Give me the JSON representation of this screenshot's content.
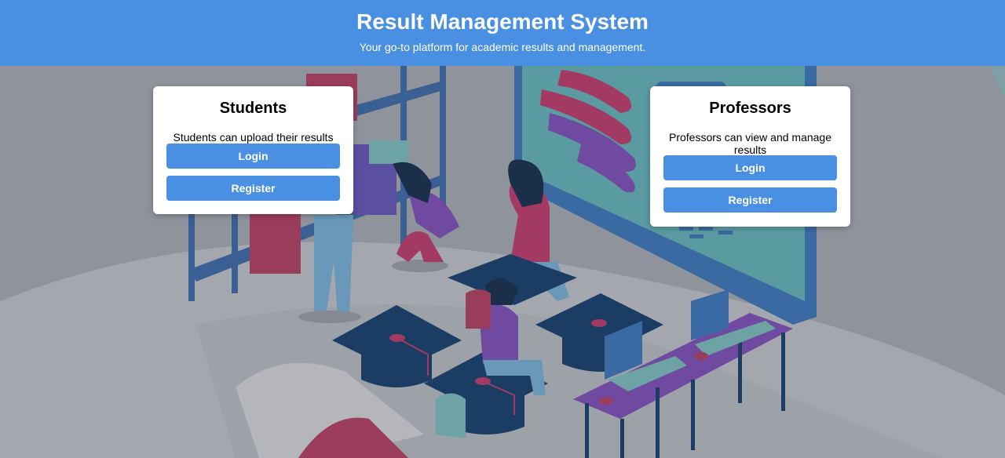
{
  "header": {
    "title": "Result Management System",
    "subtitle": "Your go-to platform for academic results and management."
  },
  "students": {
    "title": "Students",
    "description": "Students can upload their results",
    "login_label": "Login",
    "register_label": "Register"
  },
  "professors": {
    "title": "Professors",
    "description": "Professors can view and manage results",
    "login_label": "Login",
    "register_label": "Register"
  },
  "colors": {
    "accent": "#4a90e2",
    "background": "#8f939c"
  }
}
